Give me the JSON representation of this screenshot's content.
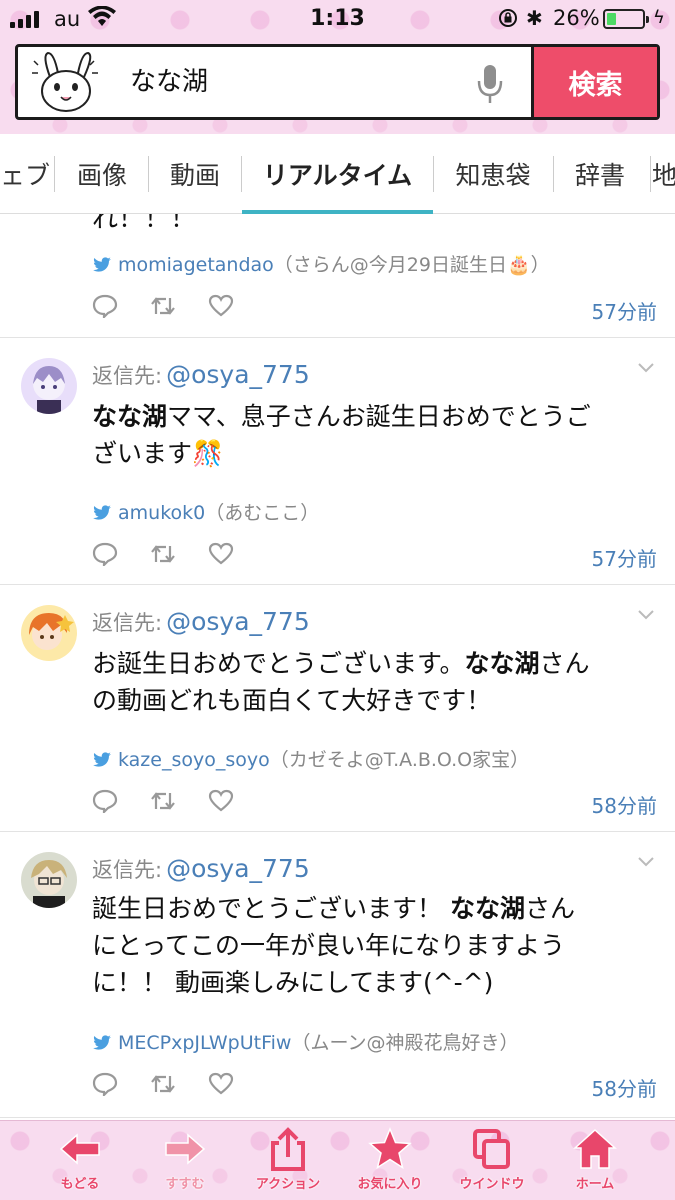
{
  "status_bar": {
    "carrier": "au",
    "time": "1:13",
    "battery_percent": "26%",
    "battery_level": 0.26
  },
  "search": {
    "query": "なな湖",
    "button_label": "検索"
  },
  "tabs": [
    {
      "label": "ェブ"
    },
    {
      "label": "画像"
    },
    {
      "label": "動画"
    },
    {
      "label": "リアルタイム",
      "active": true
    },
    {
      "label": "知恵袋"
    },
    {
      "label": "辞書"
    },
    {
      "label": "地"
    }
  ],
  "tweets": [
    {
      "partial_text": "れ！！！",
      "username": "momiagetandao",
      "display_name": "（さらん@今月29日誕生日🎂）",
      "time_ago": "57分前"
    },
    {
      "reply_label": "返信先:",
      "reply_to": "@osya_775",
      "text_lines": [
        {
          "bold": "なな湖",
          "rest": "ママ、息子さんお誕生日おめでとうご"
        },
        {
          "bold": "",
          "rest": "ざいます🎊"
        }
      ],
      "username": "amukok0",
      "display_name": "（あむここ）",
      "time_ago": "57分前"
    },
    {
      "reply_label": "返信先:",
      "reply_to": "@osya_775",
      "text_lines": [
        {
          "pre": "お誕生日おめでとうございます。",
          "bold": "なな湖",
          "rest": "さん"
        },
        {
          "pre": "の動画どれも面白くて大好きです！",
          "bold": "",
          "rest": ""
        }
      ],
      "username": "kaze_soyo_soyo",
      "display_name": "（カゼそよ@T.A.B.O.O家宝）",
      "time_ago": "58分前"
    },
    {
      "reply_label": "返信先:",
      "reply_to": "@osya_775",
      "text_lines": [
        {
          "pre": "誕生日おめでとうございます！ ",
          "bold": "なな湖",
          "rest": "さん"
        },
        {
          "pre": "にとってこの一年が良い年になりますよう",
          "bold": "",
          "rest": ""
        },
        {
          "pre": "に！！ 動画楽しみにしてます(^-^)",
          "bold": "",
          "rest": ""
        }
      ],
      "username": "MECPxpJLWpUtFiw",
      "display_name": "（ムーン@神殿花鳥好き）",
      "time_ago": "58分前"
    }
  ],
  "toolbar": [
    {
      "label": "もどる",
      "icon": "back-arrow-icon"
    },
    {
      "label": "すすむ",
      "icon": "forward-arrow-icon",
      "disabled": true
    },
    {
      "label": "アクション",
      "icon": "share-icon"
    },
    {
      "label": "お気に入り",
      "icon": "star-icon"
    },
    {
      "label": "ウインドウ",
      "icon": "windows-icon"
    },
    {
      "label": "ホーム",
      "icon": "home-icon"
    }
  ],
  "colors": {
    "accent_pink": "#ee4d6a",
    "tab_underline": "#3eb3c4",
    "link_blue": "#4a7fb7",
    "header_pink": "#f8dcef"
  }
}
